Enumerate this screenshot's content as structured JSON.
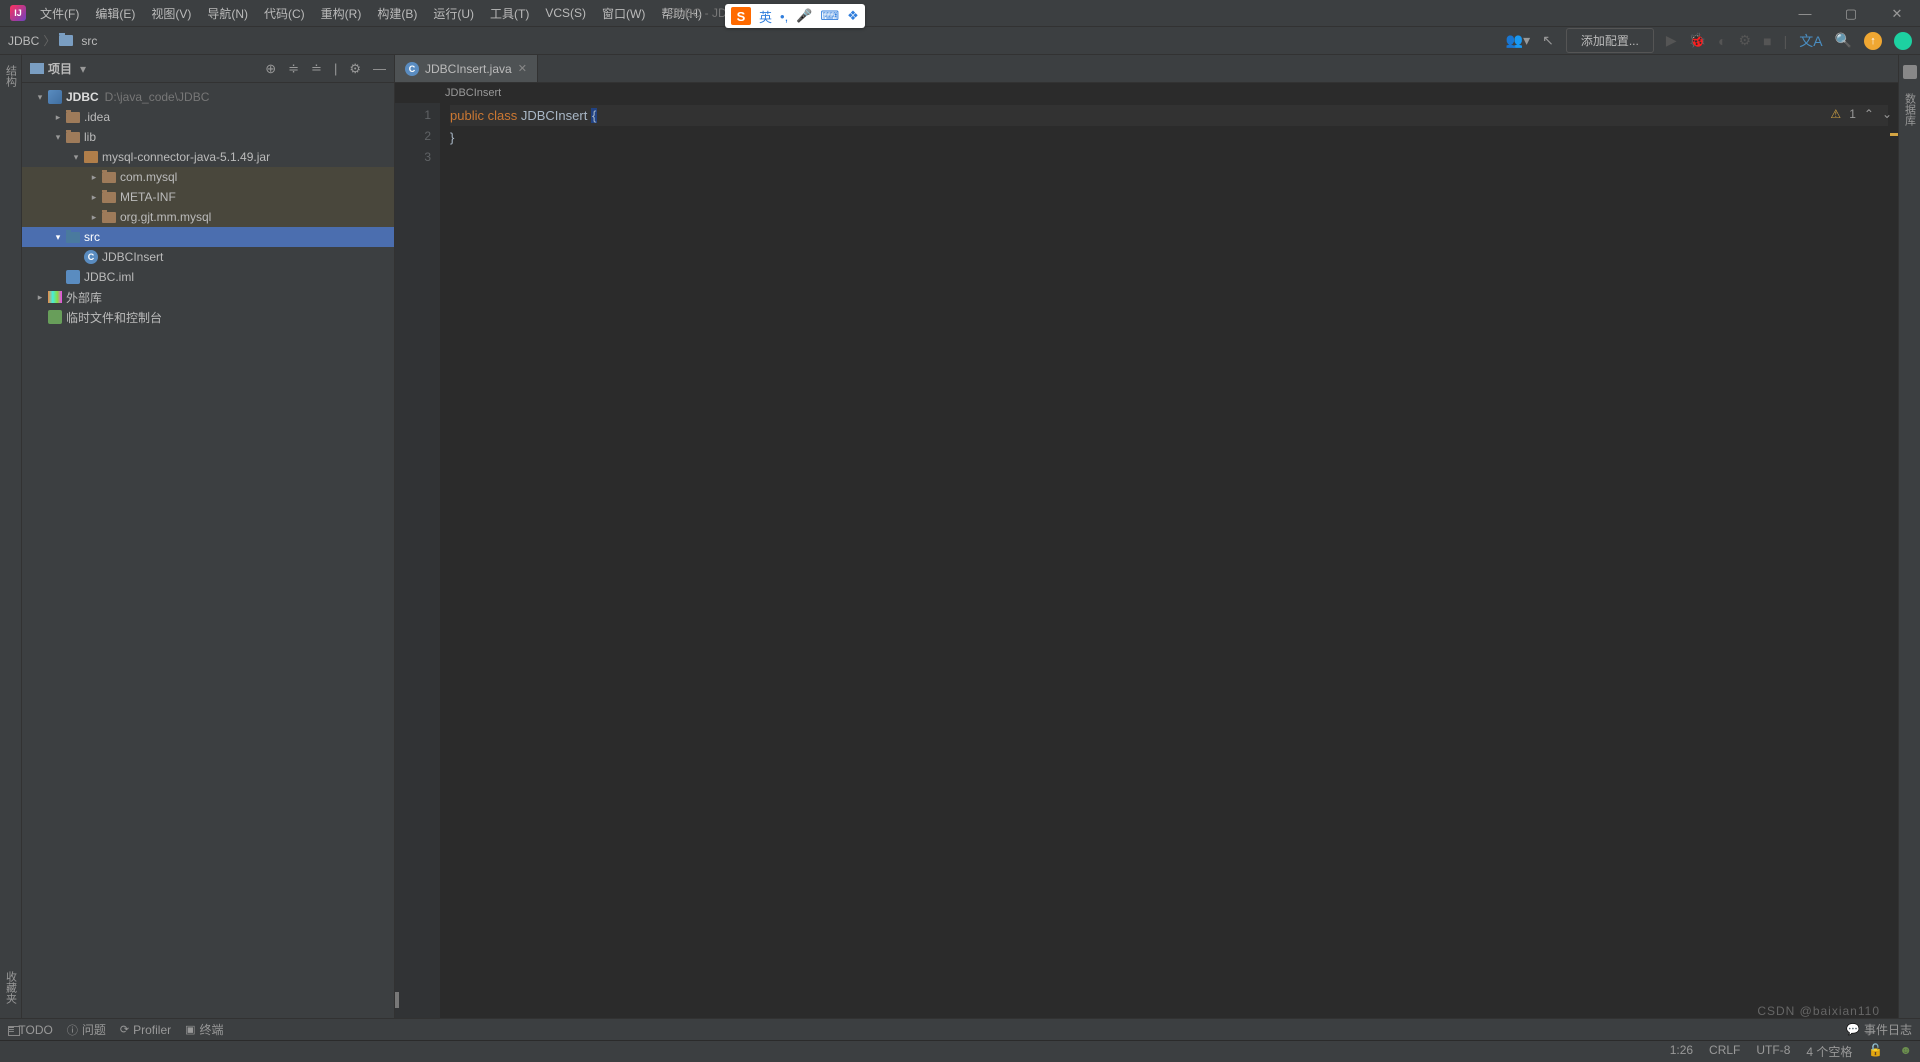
{
  "menu": {
    "file": "文件(F)",
    "edit": "编辑(E)",
    "view": "视图(V)",
    "nav": "导航(N)",
    "code": "代码(C)",
    "refactor": "重构(R)",
    "build": "构建(B)",
    "run": "运行(U)",
    "tools": "工具(T)",
    "vcs": "VCS(S)",
    "window": "窗口(W)",
    "help": "帮助(H)"
  },
  "window_title": "JDBC - JD",
  "ime": {
    "brand": "S",
    "lang": "英",
    "punct": "•,",
    "mic": "🎤",
    "grid": "⌨",
    "apps": "❖"
  },
  "breadcrumb": {
    "root": "JDBC",
    "folder": "src"
  },
  "nav_right": {
    "add_config": "添加配置..."
  },
  "panel": {
    "title": "项目"
  },
  "tree": {
    "project": {
      "name": "JDBC",
      "path": "D:\\java_code\\JDBC"
    },
    "idea": ".idea",
    "lib": "lib",
    "jar": "mysql-connector-java-5.1.49.jar",
    "pkg1": "com.mysql",
    "pkg2": "META-INF",
    "pkg3": "org.gjt.mm.mysql",
    "src": "src",
    "class": "JDBCInsert",
    "iml": "JDBC.iml",
    "ext_lib": "外部库",
    "scratch": "临时文件和控制台"
  },
  "tab": {
    "name": "JDBCInsert.java"
  },
  "editor": {
    "breadcrumb": "JDBCInsert",
    "line1": {
      "n": "1",
      "kw1": "public",
      "kw2": "class",
      "cls": "JDBCInsert",
      "brace": "{"
    },
    "line2": {
      "n": "2",
      "brace": "}"
    },
    "line3": {
      "n": "3"
    },
    "warn_count": "1"
  },
  "bottom": {
    "todo": "TODO",
    "problems": "问题",
    "profiler": "Profiler",
    "terminal": "终端",
    "events": "事件日志"
  },
  "status": {
    "pos": "1:26",
    "sep": "CRLF",
    "enc": "UTF-8",
    "spaces": "4 个空格"
  },
  "left_gutter": {
    "structure": "结构",
    "favorites": "收藏夹"
  },
  "right_gutter": {
    "database": "数据库"
  },
  "watermark": "CSDN @baixian110"
}
